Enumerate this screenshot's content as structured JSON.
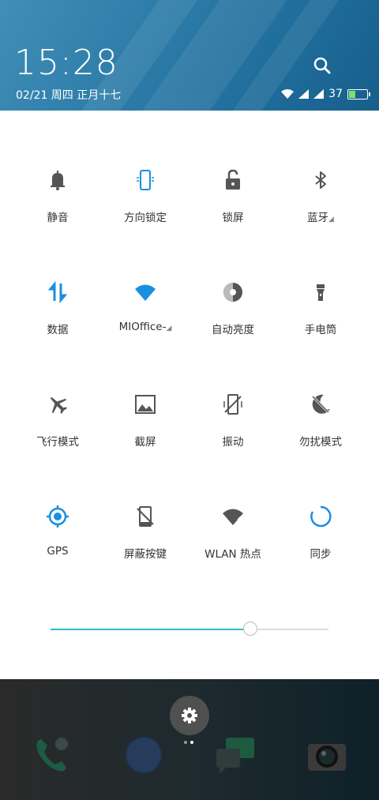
{
  "header": {
    "time": "15:28",
    "date": "02/21 周四  正月十七",
    "battery": "37",
    "battery_level_percent": 37
  },
  "tiles": [
    {
      "label": "静音",
      "icon": "bell-icon",
      "active": false
    },
    {
      "label": "方向锁定",
      "icon": "rotation-lock-icon",
      "active": true
    },
    {
      "label": "锁屏",
      "icon": "unlock-icon",
      "active": false
    },
    {
      "label": "蓝牙",
      "icon": "bluetooth-icon",
      "active": false
    },
    {
      "label": "数据",
      "icon": "mobile-data-icon",
      "active": true
    },
    {
      "label": "MIOffice-",
      "icon": "wifi-icon",
      "active": true
    },
    {
      "label": "自动亮度",
      "icon": "auto-brightness-icon",
      "active": false
    },
    {
      "label": "手电筒",
      "icon": "flashlight-icon",
      "active": false
    },
    {
      "label": "飞行模式",
      "icon": "airplane-icon",
      "active": false
    },
    {
      "label": "截屏",
      "icon": "screenshot-icon",
      "active": false
    },
    {
      "label": "振动",
      "icon": "vibrate-icon",
      "active": false
    },
    {
      "label": "勿扰模式",
      "icon": "do-not-disturb-icon",
      "active": false
    },
    {
      "label": "GPS",
      "icon": "gps-icon",
      "active": true
    },
    {
      "label": "屏蔽按键",
      "icon": "block-keys-icon",
      "active": false
    },
    {
      "label": "WLAN 热点",
      "icon": "hotspot-icon",
      "active": false
    },
    {
      "label": "同步",
      "icon": "sync-icon",
      "active": true
    }
  ],
  "brightness": {
    "level": 0.72
  },
  "colors": {
    "accent": "#1a8fe0",
    "inactive": "#555555",
    "slider": "#2dbfbf"
  },
  "dock": [
    "phone-app-icon",
    "browser-app-icon",
    "messages-app-icon",
    "camera-app-icon"
  ]
}
